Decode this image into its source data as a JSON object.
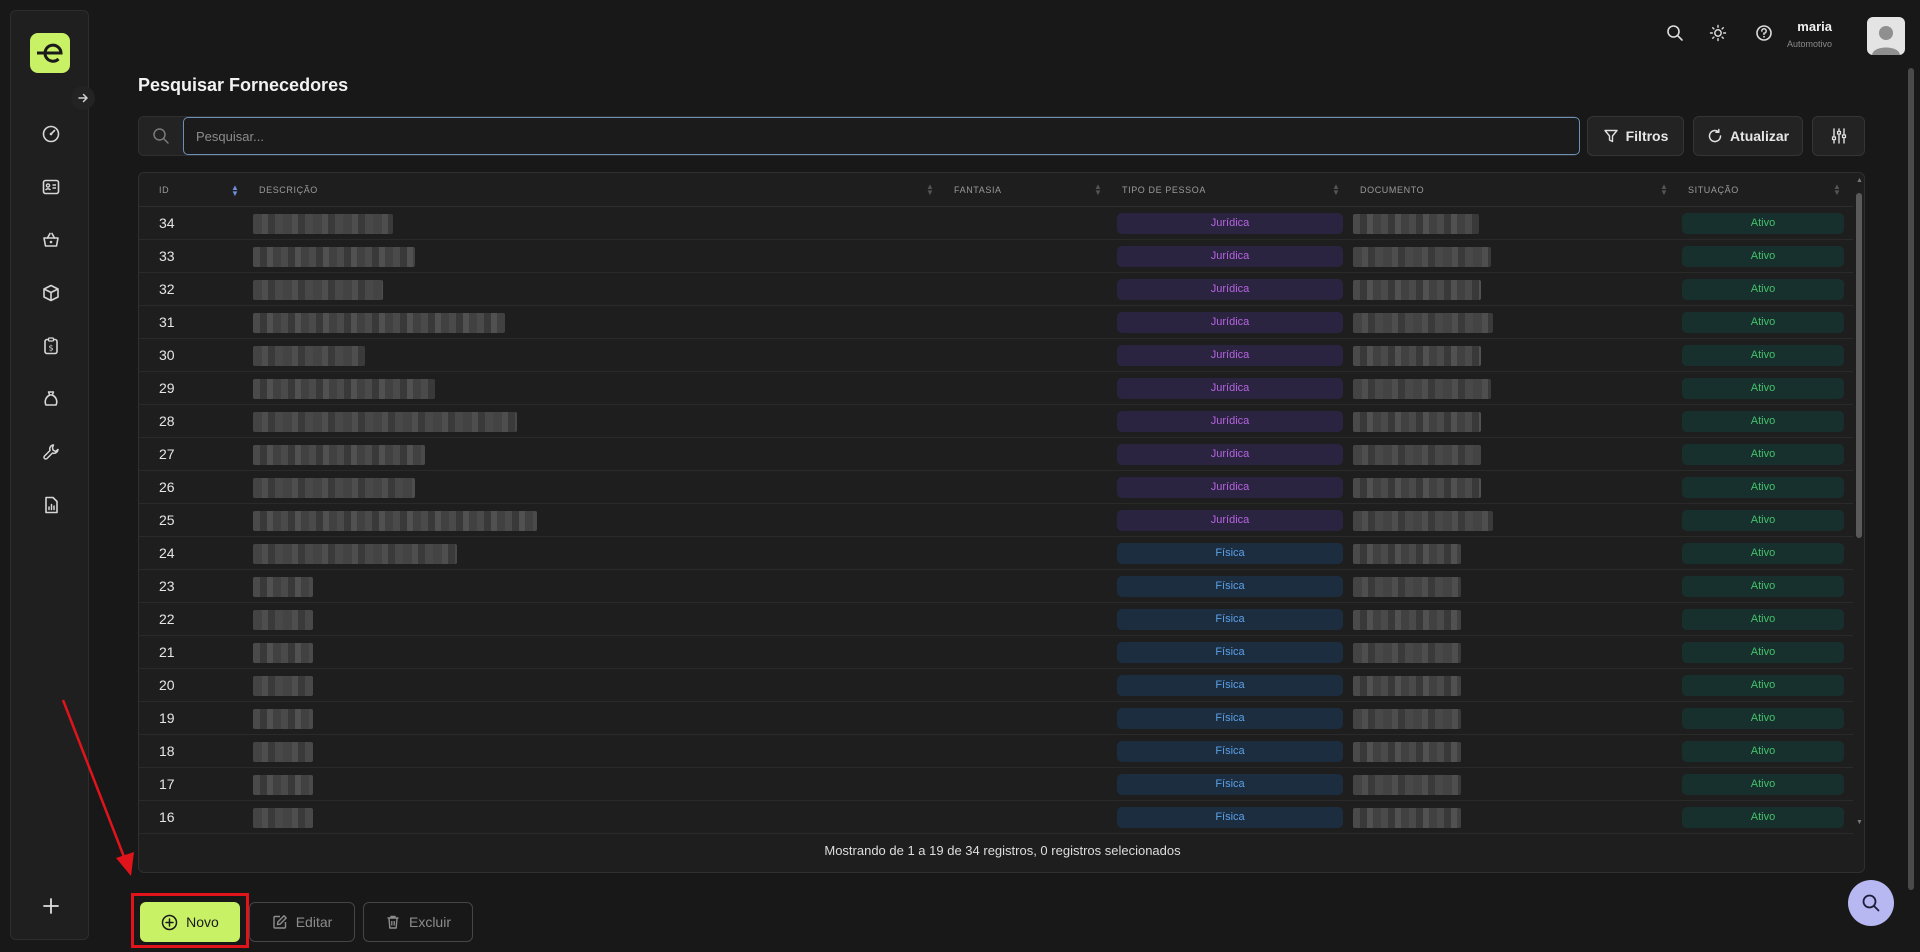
{
  "header": {
    "user_name": "maria",
    "user_subtitle": "Automotivo"
  },
  "page": {
    "title": "Pesquisar Fornecedores"
  },
  "search": {
    "placeholder": "Pesquisar...",
    "value": ""
  },
  "toolbar": {
    "filters_label": "Filtros",
    "refresh_label": "Atualizar"
  },
  "table": {
    "columns": [
      "ID",
      "DESCRIÇÃO",
      "FANTASIA",
      "TIPO DE PESSOA",
      "DOCUMENTO",
      "SITUAÇÃO"
    ],
    "rows": [
      {
        "id": "34",
        "tipo": "Jurídica",
        "situacao": "Ativo"
      },
      {
        "id": "33",
        "tipo": "Jurídica",
        "situacao": "Ativo"
      },
      {
        "id": "32",
        "tipo": "Jurídica",
        "situacao": "Ativo"
      },
      {
        "id": "31",
        "tipo": "Jurídica",
        "situacao": "Ativo"
      },
      {
        "id": "30",
        "tipo": "Jurídica",
        "situacao": "Ativo"
      },
      {
        "id": "29",
        "tipo": "Jurídica",
        "situacao": "Ativo"
      },
      {
        "id": "28",
        "tipo": "Jurídica",
        "situacao": "Ativo"
      },
      {
        "id": "27",
        "tipo": "Jurídica",
        "situacao": "Ativo"
      },
      {
        "id": "26",
        "tipo": "Jurídica",
        "situacao": "Ativo"
      },
      {
        "id": "25",
        "tipo": "Jurídica",
        "situacao": "Ativo"
      },
      {
        "id": "24",
        "tipo": "Física",
        "situacao": "Ativo"
      },
      {
        "id": "23",
        "tipo": "Física",
        "situacao": "Ativo"
      },
      {
        "id": "22",
        "tipo": "Física",
        "situacao": "Ativo"
      },
      {
        "id": "21",
        "tipo": "Física",
        "situacao": "Ativo"
      },
      {
        "id": "20",
        "tipo": "Física",
        "situacao": "Ativo"
      },
      {
        "id": "19",
        "tipo": "Física",
        "situacao": "Ativo"
      },
      {
        "id": "18",
        "tipo": "Física",
        "situacao": "Ativo"
      },
      {
        "id": "17",
        "tipo": "Física",
        "situacao": "Ativo"
      },
      {
        "id": "16",
        "tipo": "Física",
        "situacao": "Ativo"
      }
    ],
    "footer": "Mostrando de 1 a 19 de 34 registros, 0 registros selecionados"
  },
  "actions": {
    "new_label": "Novo",
    "edit_label": "Editar",
    "delete_label": "Excluir"
  },
  "colors": {
    "accent": "#c8f166",
    "juridica": "#b663e0",
    "fisica": "#5aa0e6",
    "ativo": "#43c06a",
    "highlight": "#e0141a"
  },
  "icons": {
    "sidebar": [
      "dashboard-icon",
      "id-card-icon",
      "basket-icon",
      "box-icon",
      "clipboard-money-icon",
      "money-bag-icon",
      "wrench-icon",
      "report-icon"
    ]
  }
}
